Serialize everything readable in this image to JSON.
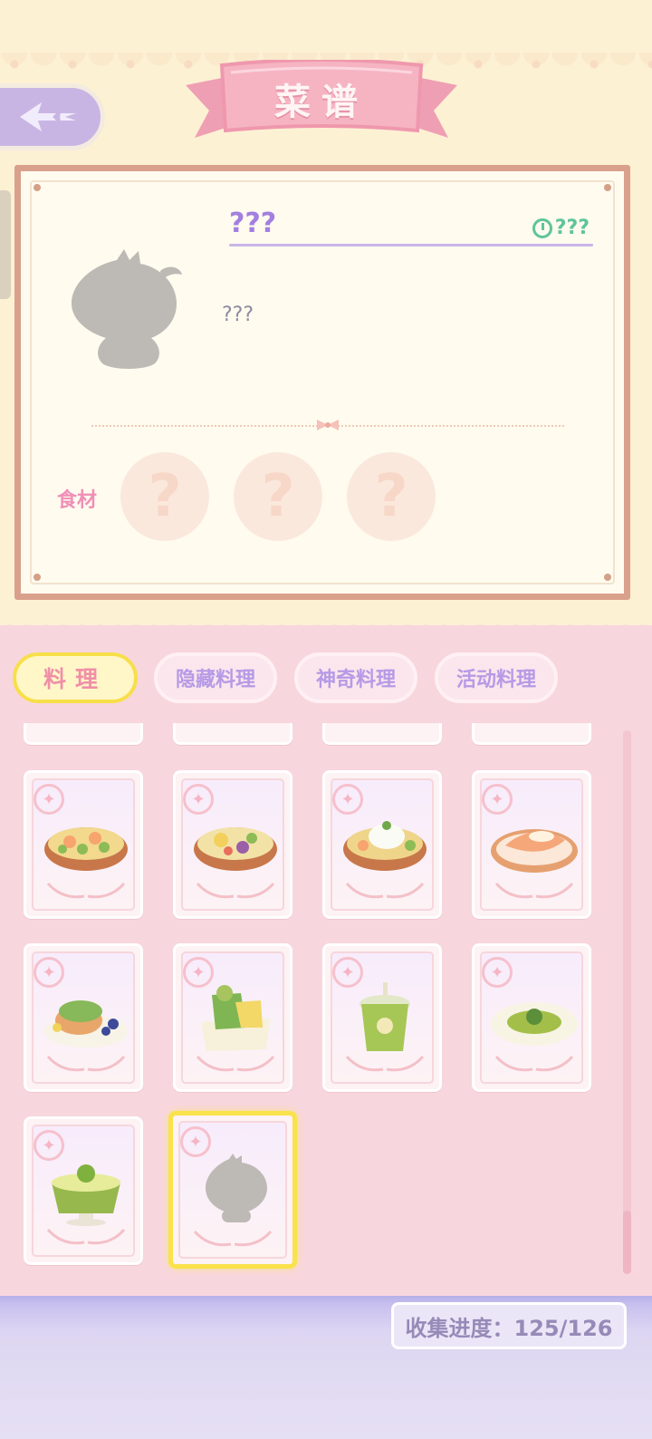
{
  "header": {
    "title": "菜谱"
  },
  "detail": {
    "name": "???",
    "time": "???",
    "description": "???",
    "ingredients_label": "食材",
    "ingredient_slots": [
      "?",
      "?",
      "?"
    ]
  },
  "tabs": [
    {
      "label": "料理",
      "active": true
    },
    {
      "label": "隐藏料理",
      "active": false
    },
    {
      "label": "神奇料理",
      "active": false
    },
    {
      "label": "活动料理",
      "active": false
    }
  ],
  "recipes": [
    {
      "icon": "shrimp-broccoli-soup-icon",
      "unlocked": true
    },
    {
      "icon": "seafood-veggie-bowl-icon",
      "unlocked": true
    },
    {
      "icon": "rice-shrimp-bowl-icon",
      "unlocked": true
    },
    {
      "icon": "fish-fillet-plate-icon",
      "unlocked": true
    },
    {
      "icon": "matcha-pancake-icon",
      "unlocked": true
    },
    {
      "icon": "frog-dessert-box-icon",
      "unlocked": true
    },
    {
      "icon": "green-bubble-drink-icon",
      "unlocked": true
    },
    {
      "icon": "green-soup-plate-icon",
      "unlocked": true
    },
    {
      "icon": "matcha-pudding-icon",
      "unlocked": true
    },
    {
      "icon": "locked-silhouette-icon",
      "unlocked": false
    }
  ],
  "progress": {
    "text": "收集进度：125/126",
    "value": 0.992
  }
}
